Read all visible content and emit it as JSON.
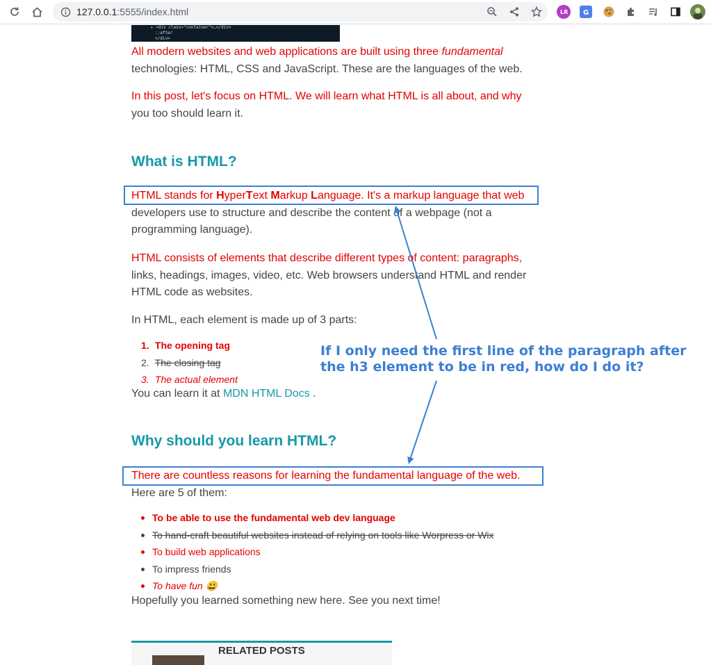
{
  "browser": {
    "url_host": "127.0.0.1",
    "url_port": ":5555",
    "url_path": "/index.html"
  },
  "article": {
    "code_lines": [
      "▸ <div class=\"container\">…</div>",
      "::after",
      "</div>"
    ],
    "intro_1_red": "All modern websites and web applications are built using three ",
    "intro_1_em": "fundamental",
    "intro_1_rest": "technologies: HTML, CSS and JavaScript. These are the languages of the web.",
    "intro_2_red": "In this post, let's focus on HTML. We will learn what HTML is all about, and why",
    "intro_2_rest": "you too should learn it.",
    "h3_what": "What is HTML?",
    "what_1_a": "HTML stands for ",
    "what_1_H": "H",
    "what_1_yper": "yper",
    "what_1_T": "T",
    "what_1_ext": "ext ",
    "what_1_M": "M",
    "what_1_arkup": "arkup ",
    "what_1_L": "L",
    "what_1_b": "anguage. It's a markup language that web",
    "what_1_rest": "developers use to structure and describe the content of a webpage (not a programming language).",
    "what_2_red": "HTML consists of elements that describe different types of content: paragraphs,",
    "what_2_rest": "links, headings, images, video, etc. Web browsers understand HTML and render HTML code as websites.",
    "what_3": "In HTML, each element is made up of 3 parts:",
    "ol": [
      {
        "num": "1.",
        "text": "The opening tag"
      },
      {
        "num": "2.",
        "text": "The closing tag"
      },
      {
        "num": "3.",
        "text": "The actual element"
      }
    ],
    "learn_prefix": "You can learn it at ",
    "learn_link": "MDN HTML Docs",
    "learn_suffix": " .",
    "h3_why": "Why should you learn HTML?",
    "why_1_red": "There are countless reasons for learning the fundamental language of the web.",
    "why_1_rest": "Here are 5 of them:",
    "ul": [
      "To be able to use the fundamental web dev language",
      "To hand-craft beautiful websites instead of relying on tools like Worpress or Wix",
      "To build web applications",
      "To impress friends",
      "To have fun 😃"
    ],
    "closing": "Hopefully you learned something new here. See you next time!",
    "related_title": "RELATED POSTS"
  },
  "annotation": {
    "line_1": "If I only need the first line of the paragraph after",
    "line_2": "the h3 element to be in red, how do I do it?",
    "color": "#3b7fd4"
  },
  "colors": {
    "red_text": "#e30000",
    "heading_teal": "#1599a8",
    "body_gray": "#444444"
  }
}
